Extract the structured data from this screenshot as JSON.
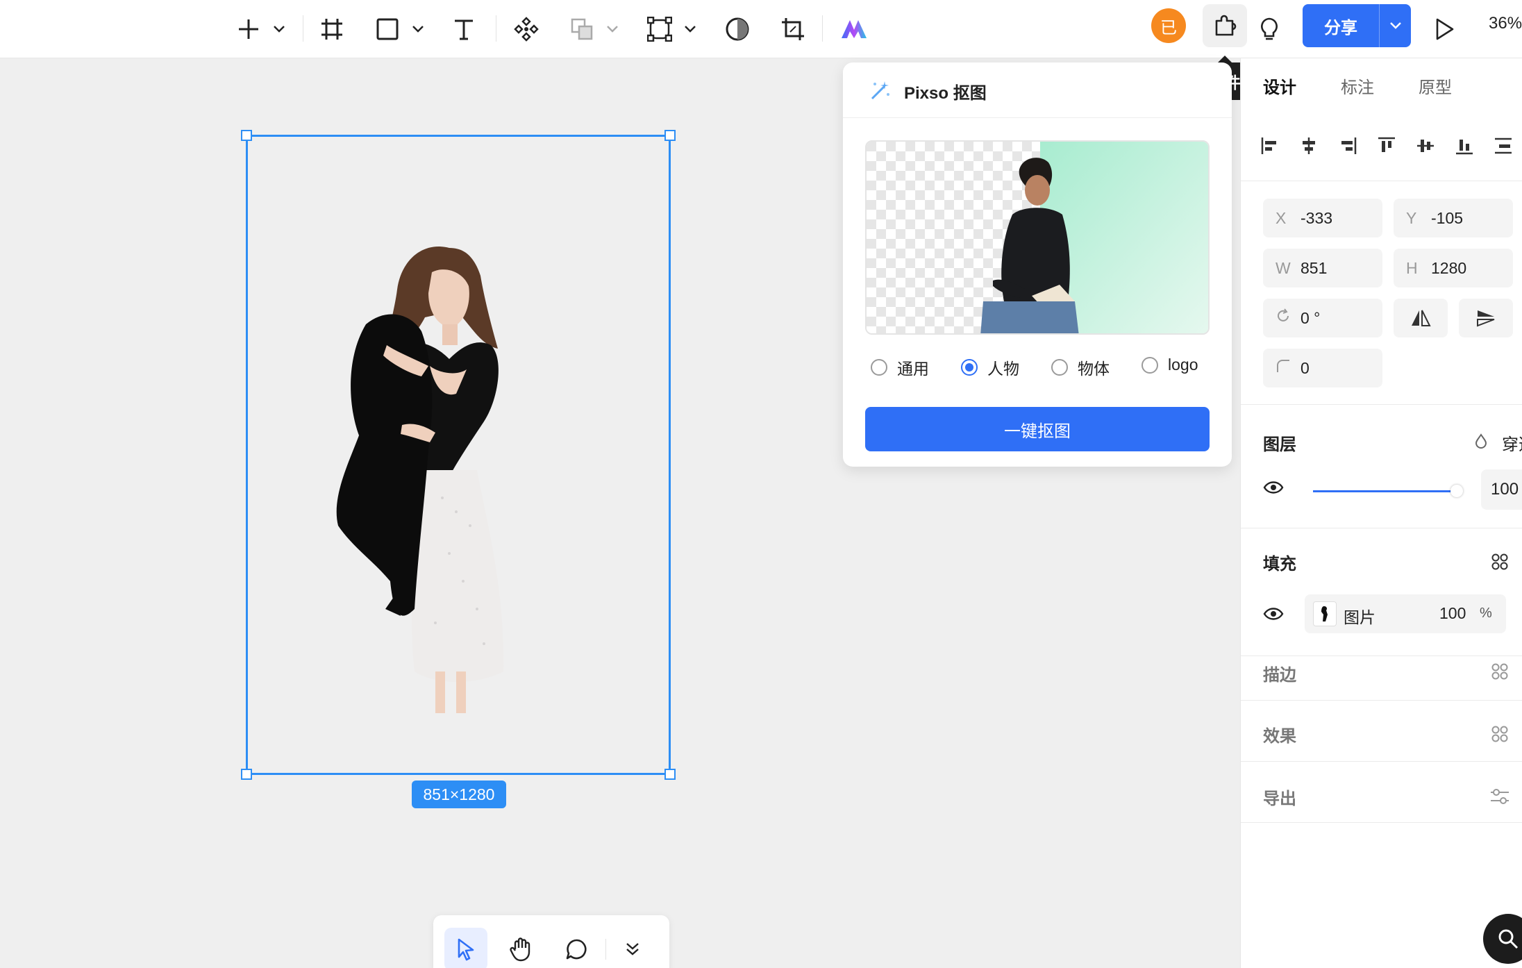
{
  "toolbar": {
    "icons": [
      "plus-icon",
      "frame-icon",
      "rectangle-icon",
      "text-icon",
      "component-icon",
      "boolean-icon",
      "vector-network-icon",
      "mask-icon",
      "crop-icon",
      "ai-logo-icon"
    ],
    "avatar_text": "已",
    "share_label": "分享",
    "zoom_label": "36%",
    "plugin_tooltip": "插件"
  },
  "canvas": {
    "selection_size": "851×1280",
    "accent": "#2d8ef5"
  },
  "plugin_panel": {
    "title": "Pixso 抠图",
    "options": [
      {
        "label": "通用",
        "selected": false
      },
      {
        "label": "人物",
        "selected": true
      },
      {
        "label": "物体",
        "selected": false
      },
      {
        "label": "logo",
        "selected": false
      }
    ],
    "action_label": "一键抠图"
  },
  "right_panel": {
    "tabs": [
      {
        "label": "设计",
        "active": true
      },
      {
        "label": "标注",
        "active": false
      },
      {
        "label": "原型",
        "active": false
      }
    ],
    "props": {
      "x_label": "X",
      "x_value": "-333",
      "y_label": "Y",
      "y_value": "-105",
      "w_label": "W",
      "w_value": "851",
      "h_label": "H",
      "h_value": "1280",
      "rotation": "0 °",
      "radius": "0"
    },
    "layer": {
      "title": "图层",
      "blend": "穿透",
      "opacity": "100",
      "opacity_fraction": 1.0
    },
    "fill": {
      "title": "填充",
      "type": "图片",
      "opacity": "100",
      "unit": "%"
    },
    "stroke_title": "描边",
    "effect_title": "效果",
    "export_title": "导出"
  },
  "colors": {
    "primary": "#2f6ff6",
    "avatar": "#f6891f"
  }
}
